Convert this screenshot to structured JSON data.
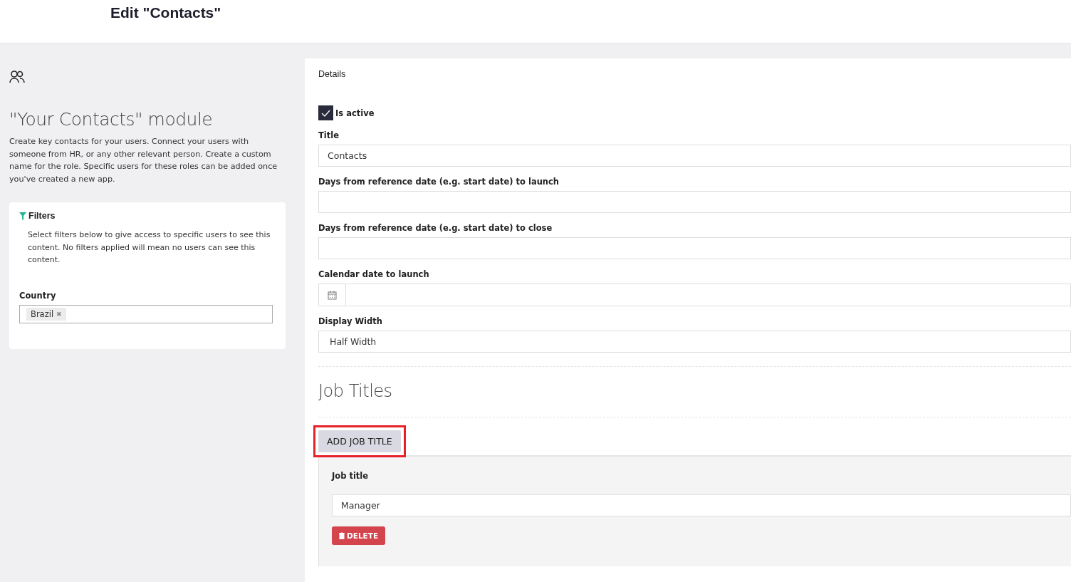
{
  "header": {
    "title": "Edit \"Contacts\""
  },
  "intro": {
    "title": "\"Your Contacts\" module",
    "description": "Create key contacts for your users. Connect your users with someone from HR, or any other relevant person. Create a custom name for the role. Specific users for these roles can be added once you've created a new app."
  },
  "filters": {
    "title": "Filters",
    "description": "Select filters below to give access to specific users to see this content. No filters applied will mean no users can see this content.",
    "country": {
      "label": "Country",
      "tags": [
        "Brazil"
      ],
      "remove_glyph": "✖"
    }
  },
  "details": {
    "title": "Details",
    "is_active": {
      "label": "Is active",
      "checked": true
    },
    "fields": [
      {
        "kind": "text",
        "label": "Title",
        "value": "Contacts"
      },
      {
        "kind": "text",
        "label": "Days from reference date (e.g. start date) to launch"
      },
      {
        "kind": "text",
        "label": "Days from reference date (e.g. start date) to close"
      },
      {
        "kind": "date",
        "label": "Calendar date to launch"
      },
      {
        "kind": "select",
        "label": "Display Width",
        "value": "Half Width"
      }
    ]
  },
  "job_titles": {
    "title": "Job Titles",
    "add_button": {
      "label": "ADD JOB TITLE",
      "highlighted": true
    },
    "items": [
      {
        "label": "Job title",
        "value": "Manager",
        "delete_label": "DELETE"
      }
    ]
  }
}
